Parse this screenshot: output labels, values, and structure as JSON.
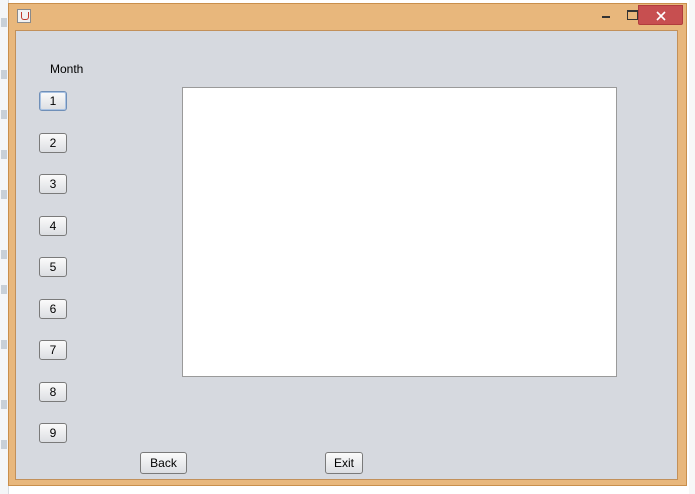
{
  "window": {
    "title": "",
    "controls": {
      "minimize": "minimize-icon",
      "maximize": "maximize-icon",
      "close": "close-icon"
    },
    "colors": {
      "frame": "#e8b77c",
      "close_button": "#c74f50",
      "client_bg": "#d6d9df",
      "panel_bg": "#ffffff"
    }
  },
  "main": {
    "month_label": "Month",
    "month_buttons": [
      "1",
      "2",
      "3",
      "4",
      "5",
      "6",
      "7",
      "8",
      "9"
    ],
    "back_label": "Back",
    "exit_label": "Exit"
  }
}
